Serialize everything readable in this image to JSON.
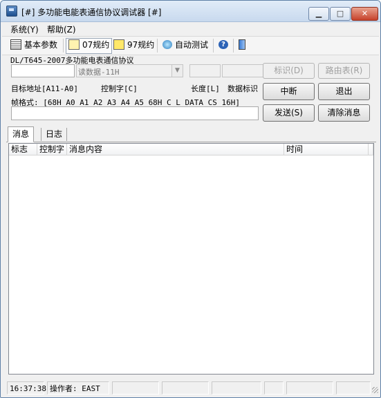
{
  "window": {
    "title": "[#] 多功能电能表通信协议调试器 [#]"
  },
  "menu": [
    "系统(Y)",
    "帮助(Z)"
  ],
  "toolbar": {
    "basic_params": "基本参数",
    "proto07": "07规约",
    "proto97": "97规约",
    "auto_test": "自动测试"
  },
  "protocol": {
    "title": "DL/T645-2007多功能电表通信协议",
    "command_select": "读数据-11H",
    "labels": {
      "target": "目标地址[A11-A0]",
      "control": "控制字[C]",
      "length": "长度[L]",
      "data_id": "数据标识"
    },
    "frame_format": "帧格式: [68H A0 A1 A2 A3 A4 A5 68H C L DATA CS 16H]",
    "buttons": {
      "identify": "标识(D)",
      "route_table": "路由表(R)",
      "interrupt": "中断",
      "exit": "退出",
      "send": "发送(S)",
      "clear": "清除消息"
    }
  },
  "tabs": [
    "消息",
    "日志"
  ],
  "table": {
    "columns": [
      "标志",
      "控制字",
      "消息内容",
      "时间"
    ]
  },
  "status": {
    "time": "16:37:38",
    "operator": "操作者: EAST"
  }
}
